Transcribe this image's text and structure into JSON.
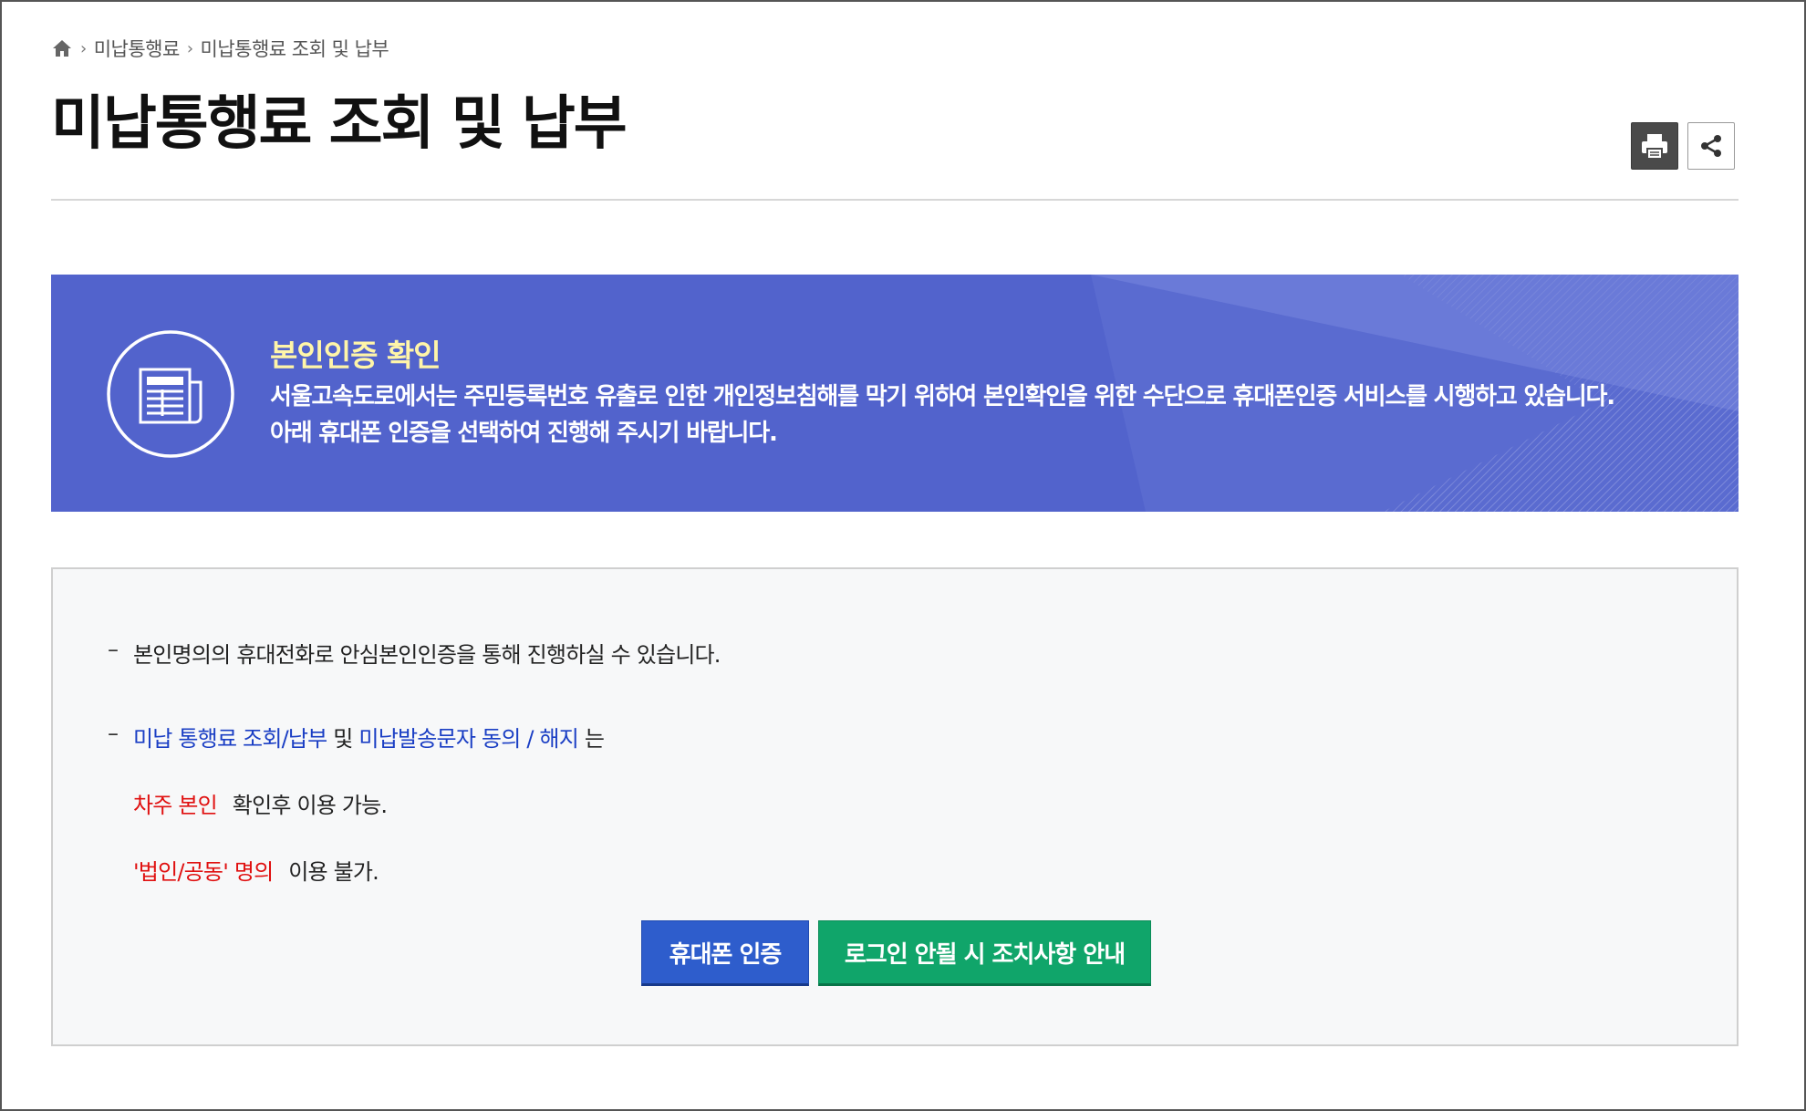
{
  "breadcrumb": {
    "home_icon": "home-icon",
    "items": [
      "미납통행료",
      "미납통행료 조회 및 납부"
    ]
  },
  "page": {
    "title": "미납통행료 조회 및 납부"
  },
  "tools": {
    "print_icon": "print-icon",
    "share_icon": "share-icon"
  },
  "banner": {
    "icon": "document-icon",
    "heading": "본인인증 확인",
    "line1": "서울고속도로에서는 주민등록번호 유출로 인한 개인정보침해를 막기 위하여 본인확인을 위한 수단으로 휴대폰인증 서비스를 시행하고 있습니다.",
    "line2": "아래 휴대폰 인증을 선택하여 진행해 주시기 바랍니다.",
    "colors": {
      "background": "#5263cc",
      "heading": "#fff5a8"
    }
  },
  "info": {
    "dash": "–",
    "notice1": "본인명의의 휴대전화로 안심본인인증을 통해 진행하실 수 있습니다.",
    "notice2_part1": "미납 통행료 조회/납부",
    "notice2_part2": " 및 ",
    "notice2_part3": "미납발송문자 동의 / 해지",
    "notice2_part4": " 는",
    "line3_red": "차주 본인",
    "line3_rest": "확인후 이용 가능.",
    "line4_red": "'법인/공동' 명의",
    "line4_rest": "이용 불가.",
    "colors": {
      "blue": "#1a3ec4",
      "red": "#e01010"
    }
  },
  "buttons": {
    "phone_auth": "휴대폰 인증",
    "login_help": "로그인 안될 시 조치사항 안내",
    "colors": {
      "phone": "#2e5dcc",
      "help": "#10a56a"
    }
  }
}
